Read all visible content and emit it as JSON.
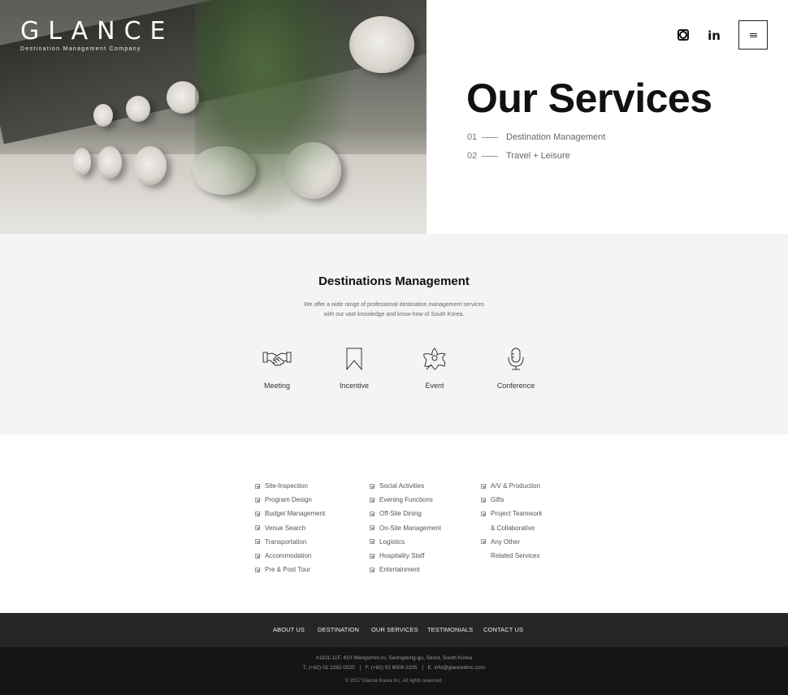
{
  "brand": {
    "name": "GLANCE",
    "tagline": "Destination Management Company"
  },
  "header": {
    "instagram_icon": "instagram-icon",
    "linkedin_icon_text": "in",
    "menu_icon": "hamburger-icon"
  },
  "hero": {
    "title": "Our Services",
    "links": [
      {
        "num": "01",
        "label": "Destination Management"
      },
      {
        "num": "02",
        "label": "Travel + Leisure"
      }
    ]
  },
  "destination_management": {
    "title": "Destinations Management",
    "description_line1": "We offer a wide range of professional destination management services",
    "description_line2": "with our vast  knowledge and know-how of South Korea.",
    "features": [
      {
        "label": "Meeting",
        "icon": "handshake-icon"
      },
      {
        "label": "Incentive",
        "icon": "bookmark-icon"
      },
      {
        "label": "Event",
        "icon": "flower-icon"
      },
      {
        "label": "Conference",
        "icon": "microphone-icon"
      }
    ]
  },
  "services": {
    "col1": [
      "Site-Inspection",
      "Program Design",
      "Budget Management",
      "Venue Search",
      "Transportation",
      "Accommodation",
      "Pre & Post Tour"
    ],
    "col2": [
      "Social Activities",
      "Evening Functions",
      "Off-Site Dining",
      "On-Site Management",
      "Logistics",
      "Hospitality Staff",
      "Entertainment"
    ],
    "col3": [
      "A/V & Production",
      "Gifts",
      "Project Teamwork",
      "& Collaborative",
      "Any Other",
      "Related Services"
    ]
  },
  "footer": {
    "nav": [
      "ABOUT US",
      "DESTINATION",
      "OUR SERVICES",
      "TESTIMONIALS",
      "CONTACT US"
    ],
    "address": "#1101-11F, 410 Wangsimni-ro, Seongdong-gu, Seoul, South Korea",
    "phone": "T. (+82) 02 2282 0225",
    "fax": "F. (+82) 02 6008 2205",
    "email": "E. info@glancedmc.com",
    "copyright": "© 2017 Glance Korea Inc. All rights reserved."
  }
}
